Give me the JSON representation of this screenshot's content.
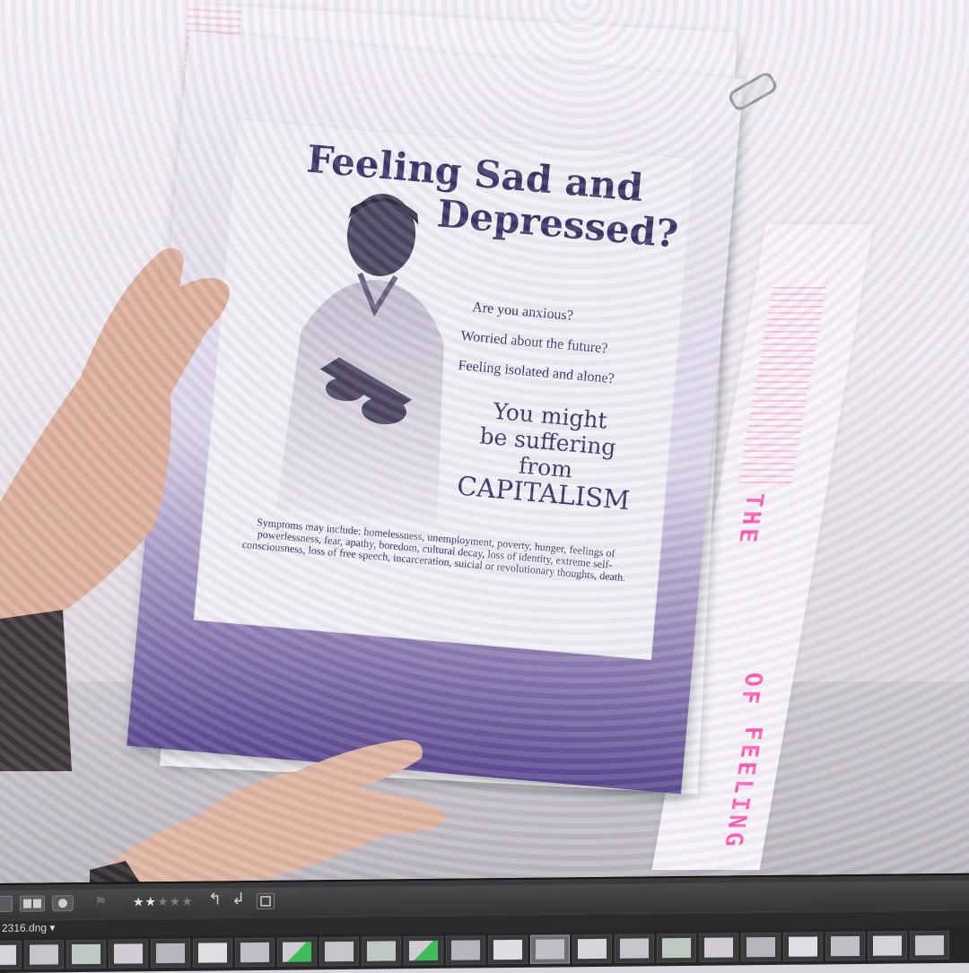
{
  "poster": {
    "title_line1": "Feeling Sad and",
    "title_line2": "Depressed?",
    "questions": [
      "Are you anxious?",
      "Worried about the future?",
      "Feeling isolated and alone?"
    ],
    "callout_lines": [
      "You might",
      "be suffering",
      "from"
    ],
    "callout_emphasis": "CAPITALISM",
    "symptoms": "Symptoms may include: homelessness, unemployment, poverty, hunger, feelings of powerlessness, fear, apathy, boredom, cultural decay, loss of identity, extreme self-consciousness, loss of free speech, incarceration, suicial or revolutionary thoughts, death.",
    "ink_color": "#2a2458",
    "gradient_color": "#4b3b86"
  },
  "side_strip": {
    "pink_texts": [
      "THE",
      "OF",
      "FEELING"
    ],
    "pink_color": "#ff4fae"
  },
  "lightroom": {
    "rating": {
      "value": 2,
      "max": 5,
      "on_glyph": "★★",
      "off_glyph": "★★★"
    },
    "filename": "2316.dng",
    "filename_dropdown_glyph": "▾",
    "toolbar_icons": {
      "grid": "grid-view-icon",
      "compare": "compare-view-icon",
      "survey": "survey-view-icon",
      "flag": "flag-icon",
      "rotate_left": "↰",
      "rotate_right": "↲",
      "crop": "crop-icon"
    },
    "filmstrip_count": 23,
    "selected_index": 13
  }
}
